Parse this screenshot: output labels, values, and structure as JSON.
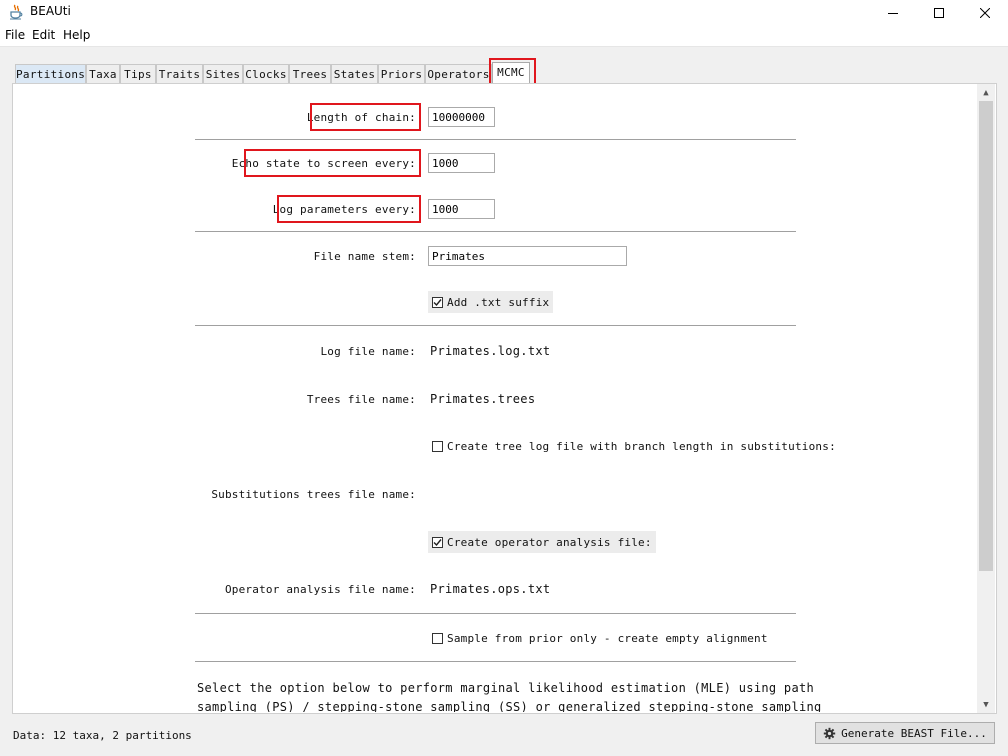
{
  "window": {
    "title": "BEAUti",
    "icon": "java-cup-icon"
  },
  "menu": [
    "File",
    "Edit",
    "Help"
  ],
  "tabs": [
    "Partitions",
    "Taxa",
    "Tips",
    "Traits",
    "Sites",
    "Clocks",
    "Trees",
    "States",
    "Priors",
    "Operators",
    "MCMC"
  ],
  "active_tab": "MCMC",
  "mcmc": {
    "length_of_chain_label": "Length of chain:",
    "length_of_chain_value": "10000000",
    "echo_label": "Echo state to screen every:",
    "echo_value": "1000",
    "log_params_label": "Log parameters every:",
    "log_params_value": "1000",
    "file_stem_label": "File name stem:",
    "file_stem_value": "Primates",
    "add_txt_label": "Add .txt suffix",
    "add_txt_checked": true,
    "log_file_label": "Log file name:",
    "log_file_value": "Primates.log.txt",
    "trees_file_label": "Trees file name:",
    "trees_file_value": "Primates.trees",
    "tree_subst_label": "Create tree log file with branch length in substitutions:",
    "tree_subst_checked": false,
    "subst_trees_label": "Substitutions trees file name:",
    "op_analysis_label": "Create operator analysis file:",
    "op_analysis_checked": true,
    "op_file_label": "Operator analysis file name:",
    "op_file_value": "Primates.ops.txt",
    "sample_prior_label": "Sample from prior only - create empty alignment",
    "sample_prior_checked": false,
    "mle_text_line1": "Select the option below to perform marginal likelihood estimation (MLE) using path",
    "mle_text_line2": "sampling (PS) / stepping-stone sampling (SS) or generalized stepping-stone sampling"
  },
  "status": {
    "text": "Data: 12 taxa, 2 partitions"
  },
  "generate_button": "Generate BEAST File...",
  "colors": {
    "highlight": "#e0161d",
    "accent_tab": "#dbe8f5"
  }
}
